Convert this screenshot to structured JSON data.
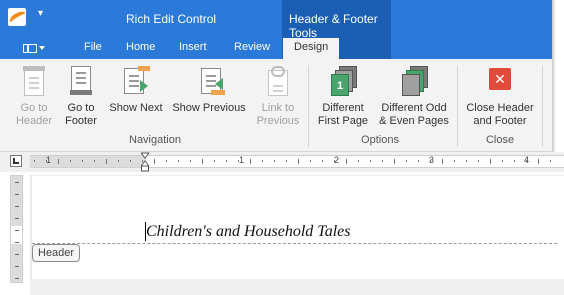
{
  "window": {
    "title": "Rich Edit Control",
    "context_group": "Header & Footer Tools",
    "qat_glyph": "▾"
  },
  "tabs": [
    {
      "label": "File",
      "active": false
    },
    {
      "label": "Home",
      "active": false
    },
    {
      "label": "Insert",
      "active": false
    },
    {
      "label": "Review",
      "active": false
    },
    {
      "label": "Design",
      "active": true
    }
  ],
  "ribbon": {
    "groups": {
      "navigation": "Navigation",
      "options": "Options",
      "close": "Close"
    },
    "buttons": {
      "go_to_header": {
        "line1": "Go to",
        "line2": "Header",
        "enabled": false,
        "icon": "go-to-header-icon"
      },
      "go_to_footer": {
        "line1": "Go to",
        "line2": "Footer",
        "enabled": true,
        "icon": "go-to-footer-icon"
      },
      "show_next": {
        "line1": "Show Next",
        "line2": "",
        "enabled": true,
        "icon": "show-next-icon"
      },
      "show_previous": {
        "line1": "Show Previous",
        "line2": "",
        "enabled": true,
        "icon": "show-previous-icon"
      },
      "link_to_previous": {
        "line1": "Link to",
        "line2": "Previous",
        "enabled": false,
        "icon": "link-to-previous-icon"
      },
      "different_first_page": {
        "line1": "Different",
        "line2": "First Page",
        "enabled": true,
        "icon": "different-first-page-icon",
        "badge": "1"
      },
      "different_odd_even": {
        "line1": "Different Odd",
        "line2": "& Even Pages",
        "enabled": true,
        "icon": "different-odd-even-icon"
      },
      "close_header_footer": {
        "line1": "Close Header",
        "line2": "and Footer",
        "enabled": true,
        "icon": "close-x-icon",
        "glyph": "✕"
      }
    }
  },
  "ruler": {
    "numbers": [
      "1",
      "1",
      "2",
      "3",
      "4"
    ]
  },
  "document": {
    "header_text": "Children's and Household Tales",
    "header_tag": "Header"
  },
  "colors": {
    "title_bar": "#2b79d8",
    "context_group": "#1a5fb4",
    "ribbon_bg": "#f3f3f3",
    "accent_orange": "#f0a34a",
    "accent_green": "#4aa56d",
    "close_red": "#e04a3a"
  }
}
